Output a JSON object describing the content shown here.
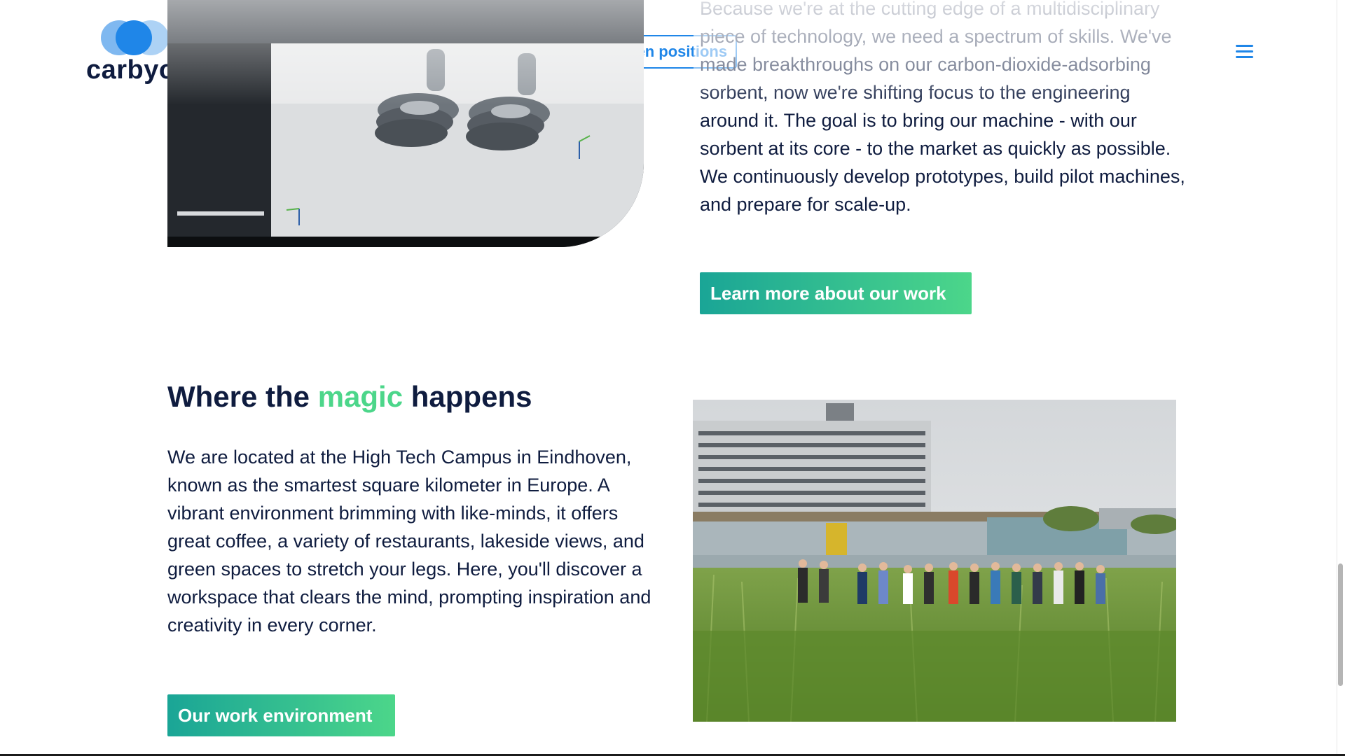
{
  "header": {
    "logo_text": "carbyon",
    "open_positions_label": "Open positions",
    "menu_icon": "hamburger-menu-icon"
  },
  "work": {
    "paragraph": "Because we're at the cutting edge of a multidisciplinary piece of technology, we need a spectrum of skills. We've made breakthroughs on our carbon-dioxide-adsorbing sorbent, now we're shifting focus to the engineering around it. The goal is to bring our machine - with our sorbent at its core - to the market as quickly as possible. We continuously develop prototypes, build pilot machines, and prepare for scale-up.",
    "button_label": "Learn more about our work"
  },
  "location": {
    "heading_before": "Where the ",
    "heading_accent": "magic",
    "heading_after": " happens",
    "paragraph": "We are located at the High Tech Campus in Eindhoven, known as the smartest square kilometer in Europe. A vibrant environment brimming with like-minds, it offers great coffee, a variety of restaurants, lakeside views, and green spaces to stretch your legs. Here, you'll discover a workspace that clears the mind, prompting inspiration and creativity in every corner.",
    "button_label": "Our work environment"
  },
  "colors": {
    "brand_blue": "#1f86e8",
    "navy_text": "#0f1c3f",
    "accent_green": "#4cd68a",
    "gradient_teal": "#1aa596"
  }
}
